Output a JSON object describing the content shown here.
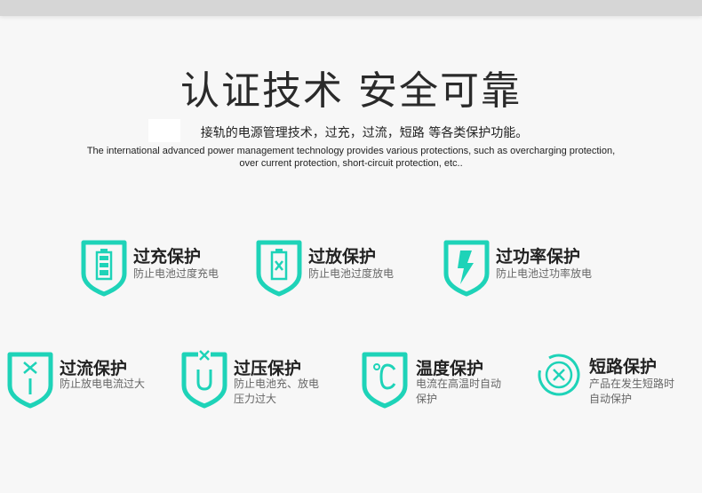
{
  "header": {
    "title": "认证技术 安全可靠",
    "subtitle_cn": "接轨的电源管理技术，过充，过流，短路 等各类保护功能。",
    "subtitle_en_1": "The international advanced power management technology provides various protections, such as overcharging protection,",
    "subtitle_en_2": "over current protection, short-circuit protection, etc.."
  },
  "colors": {
    "accent": "#1ed3b8",
    "top_bar": "#d6d6d6"
  },
  "features": [
    {
      "title": "过充保护",
      "desc_1": "防止电池过度充电",
      "desc_2": "",
      "icon": "battery-full-shield-icon"
    },
    {
      "title": "过放保护",
      "desc_1": "防止电池过度放电",
      "desc_2": "",
      "icon": "battery-x-shield-icon"
    },
    {
      "title": "过功率保护",
      "desc_1": "防止电池过功率放电",
      "desc_2": "",
      "icon": "lightning-shield-icon"
    },
    {
      "title": "过流保护",
      "desc_1": "防止放电电流过大",
      "desc_2": "",
      "icon": "current-x-shield-icon"
    },
    {
      "title": "过压保护",
      "desc_1": "防止电池充、放电",
      "desc_2": "压力过大",
      "icon": "voltage-u-shield-icon"
    },
    {
      "title": "温度保护",
      "desc_1": "电流在高温时自动",
      "desc_2": "保护",
      "icon": "celsius-shield-icon"
    },
    {
      "title": "短路保护",
      "desc_1": "产品在发生短路时",
      "desc_2": "自动保护",
      "icon": "short-circuit-x-icon"
    }
  ]
}
